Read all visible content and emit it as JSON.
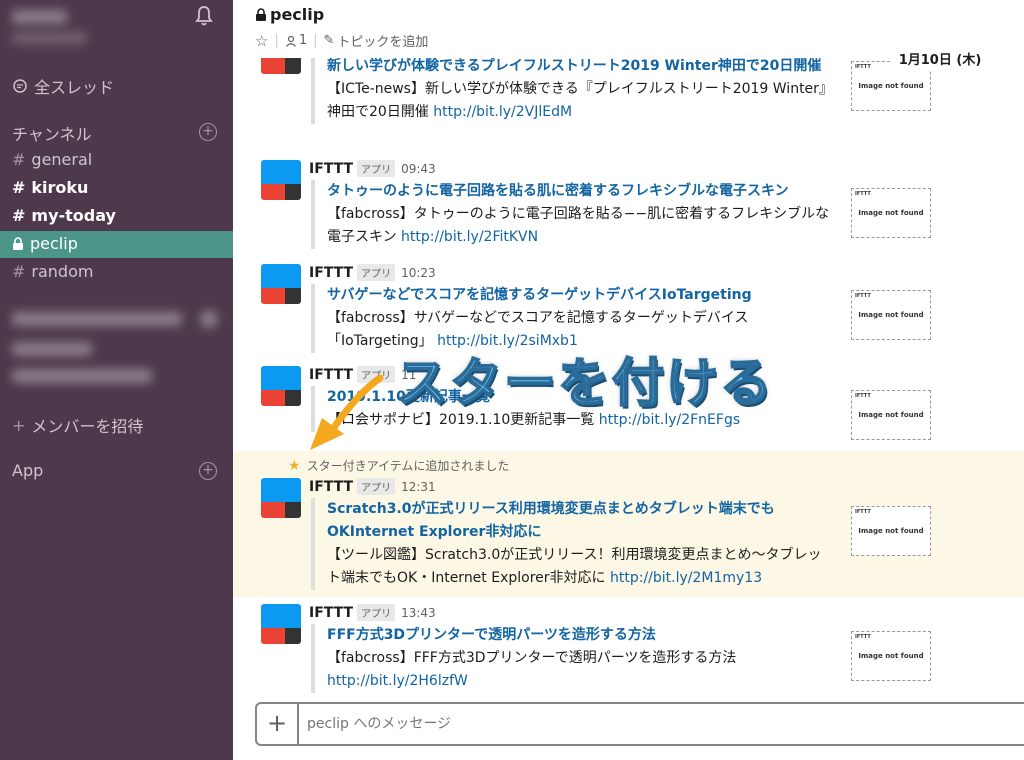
{
  "sidebar": {
    "all_threads": "全スレッド",
    "channels_heading": "チャンネル",
    "channels": [
      {
        "name": "general",
        "bold": false
      },
      {
        "name": "kiroku",
        "bold": true
      },
      {
        "name": "my-today",
        "bold": true
      },
      {
        "name": "peclip",
        "bold": false,
        "active": true,
        "locked": true
      },
      {
        "name": "random",
        "bold": false
      }
    ],
    "invite_members": "メンバーを招待",
    "app_heading": "App"
  },
  "header": {
    "channel_name": "peclip",
    "member_count": "1",
    "add_topic": "トピックを追加",
    "date": "1月10日 (木)"
  },
  "messages": [
    {
      "title": "新しい学びが体験できるプレイフルストリート2019 Winter神田で20日開催",
      "body": "【ICTe-news】新しい学びが体験できる『プレイフルストリート2019 Winter』神田で20日開催",
      "link": "http://bit.ly/2VJlEdM"
    },
    {
      "name": "IFTTT",
      "badge": "アプリ",
      "time": "09:43",
      "title": "タトゥーのように電子回路を貼る肌に密着するフレキシブルな電子スキン",
      "body": "【fabcross】タトゥーのように電子回路を貼る−−肌に密着するフレキシブルな電子スキン",
      "link": "http://bit.ly/2FitKVN"
    },
    {
      "name": "IFTTT",
      "badge": "アプリ",
      "time": "10:23",
      "title": "サバゲーなどでスコアを記憶するターゲットデバイスIoTargeting",
      "body": "【fabcross】サバゲーなどでスコアを記憶するターゲットデバイス「IoTargeting」",
      "link": "http://bit.ly/2siMxb1"
    },
    {
      "name": "IFTTT",
      "badge": "アプリ",
      "time": "11",
      "title": "2019.1.10更新記事一覧",
      "body": "【ロ会サポナビ】2019.1.10更新記事一覧",
      "link": "http://bit.ly/2FnEFgs"
    },
    {
      "name": "IFTTT",
      "badge": "アプリ",
      "time": "12:31",
      "title": "Scratch3.0が正式リリース利用環境変更点まとめタブレット端末でもOKInternet Explorer非対応に",
      "body": "【ツール図鑑】Scratch3.0が正式リリース！利用環境変更点まとめ〜タブレット端末でもOK・Internet Explorer非対応に",
      "link": "http://bit.ly/2M1my13"
    },
    {
      "name": "IFTTT",
      "badge": "アプリ",
      "time": "13:43",
      "title": "FFF方式3Dプリンターで透明パーツを造形する方法",
      "body": "【fabcross】FFF方式3Dプリンターで透明パーツを造形する方法",
      "link": "http://bit.ly/2H6lzfW"
    }
  ],
  "thumb": {
    "brand": "IFTTT",
    "not_found": "Image not found"
  },
  "star_note": "スター付きアイテムに追加されました",
  "composer": {
    "placeholder": "peclip へのメッセージ"
  },
  "annotation": "スターを付ける",
  "colors": {
    "sidebar": "#4d394b",
    "active": "#4c9689",
    "link": "#1264a3",
    "highlight": "#fdf8e5",
    "star": "#ecb22e"
  }
}
